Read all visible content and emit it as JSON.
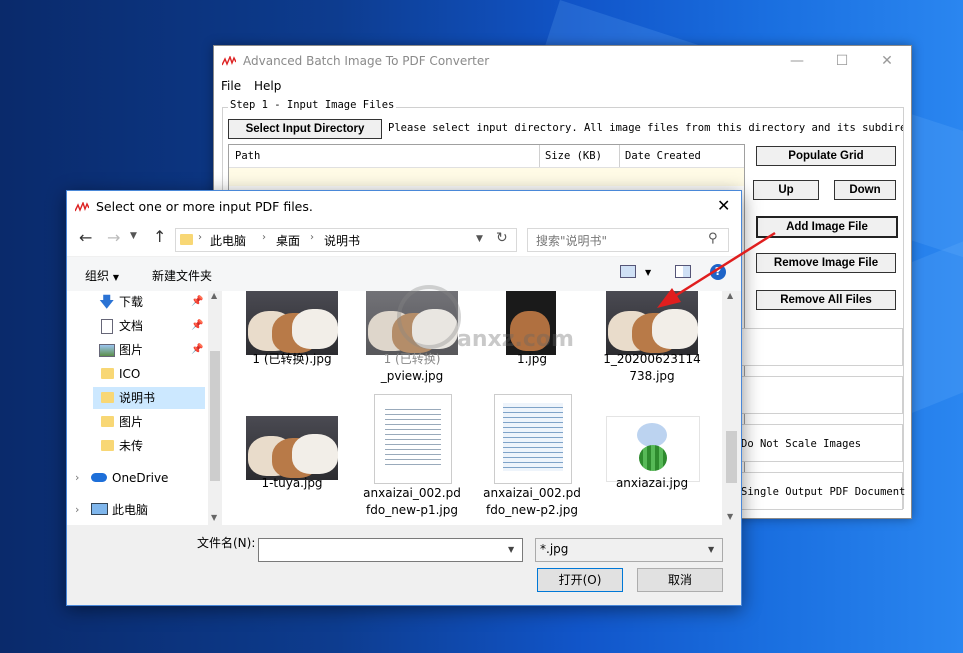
{
  "app": {
    "title": "Advanced Batch Image To PDF Converter",
    "menu": [
      "File",
      "Help"
    ],
    "step_label": "Step 1 - Input Image Files",
    "select_dir_label": "Select Input Directory",
    "instruction": "Please select input directory. All image files from this directory and its subdirector",
    "columns": [
      "Path",
      "Size (KB)",
      "Date Created"
    ],
    "buttons": {
      "populate": "Populate Grid",
      "up": "Up",
      "down": "Down",
      "add": "Add Image File",
      "remove": "Remove Image File",
      "remove_all": "Remove All Files"
    },
    "options": [
      "Do Not Scale Images",
      "Single Output PDF Document"
    ]
  },
  "dialog": {
    "title": "Select one or more input PDF files.",
    "breadcrumb": [
      "此电脑",
      "桌面",
      "说明书"
    ],
    "search_placeholder": "搜索\"说明书\"",
    "organize": "组织",
    "new_folder": "新建文件夹",
    "nav": [
      {
        "label": "下载",
        "icon": "download-icon",
        "pinned": true
      },
      {
        "label": "文档",
        "icon": "document-icon",
        "pinned": true
      },
      {
        "label": "图片",
        "icon": "picture-icon",
        "pinned": true
      },
      {
        "label": "ICO",
        "icon": "folder-icon"
      },
      {
        "label": "说明书",
        "icon": "folder-icon",
        "selected": true
      },
      {
        "label": "图片",
        "icon": "folder-icon"
      },
      {
        "label": "未传",
        "icon": "folder-icon"
      },
      {
        "label": "OneDrive",
        "icon": "cloud-icon"
      },
      {
        "label": "此电脑",
        "icon": "computer-icon"
      }
    ],
    "files": [
      {
        "line1": "1 (已转换).jpg",
        "line2": ""
      },
      {
        "line1": "1 (已转换)",
        "line2": "_pview.jpg"
      },
      {
        "line1": "1.jpg",
        "line2": ""
      },
      {
        "line1": "1_20200623114",
        "line2": "738.jpg"
      },
      {
        "line1": "1-tuya.jpg",
        "line2": ""
      },
      {
        "line1": "anxaizai_002.pd",
        "line2": "fdo_new-p1.jpg"
      },
      {
        "line1": "anxaizai_002.pd",
        "line2": "fdo_new-p2.jpg"
      },
      {
        "line1": "anxiazai.jpg",
        "line2": ""
      }
    ],
    "filename_label": "文件名(N):",
    "filename_value": "",
    "filter_value": "*.jpg",
    "open_label": "打开(O)",
    "cancel_label": "取消"
  },
  "watermark": "anxz.com"
}
